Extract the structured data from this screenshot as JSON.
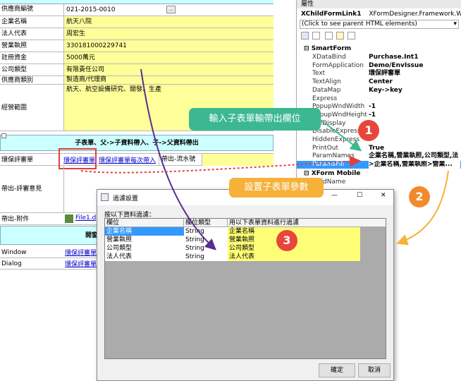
{
  "form": {
    "rows": [
      {
        "label": "供應商編號",
        "value": "021-2015-0010"
      },
      {
        "label": "企業名稱",
        "value": "航天八院"
      },
      {
        "label": "法人代表",
        "value": "周宏生"
      },
      {
        "label": "營業執照",
        "value": "330181000229741"
      },
      {
        "label": "註冊資金",
        "value": "5000萬元"
      },
      {
        "label": "公司類型",
        "value": "有限責任公司"
      },
      {
        "label": "供應商類別",
        "value": "製造商/代理商"
      },
      {
        "label": "經營範圍",
        "value": "航天、航空設備研究、開發、生產"
      }
    ],
    "band_title": "子表單、父->子資料帶入、子->父資料帶出",
    "sub_rows": {
      "env_label": "環保評審單",
      "env_link1": "環保評審單",
      "env_link2": "環保評審單每次帶入",
      "env_cell3": "帶出-流水號",
      "opinion_label": "帶出-評審意見",
      "attach_label": "帶出-附件",
      "attach_file": "File1.d",
      "open_band": "開窗",
      "window_label": "Window",
      "window_link": "環保評審單",
      "dialog_label": "Dialog",
      "dialog_link": "環保評審單"
    }
  },
  "properties": {
    "header": "屬性",
    "object_name": "XChildFormLink1",
    "object_type": "XFormDesigner.Framework.Web.UI.C(",
    "parent_hint": "(Click to see parent HTML elements)",
    "section_smartform": "SmartForm",
    "section_xform_mobile": "XForm Mobile",
    "rows": [
      {
        "name": "XDataBind",
        "value": "Purchase.Int1"
      },
      {
        "name": "FormApplication",
        "value": "Demo/EnvIssue"
      },
      {
        "name": "Text",
        "value": "環保評審單"
      },
      {
        "name": "TextAlign",
        "value": "Center"
      },
      {
        "name": "DataMap",
        "value": "Key->key"
      },
      {
        "name": "Express",
        "value": ""
      },
      {
        "name": "PopupWndWidth",
        "value": "-1"
      },
      {
        "name": "PopupWndHeight",
        "value": "-1"
      },
      {
        "name": "PreDisplay",
        "value": ""
      },
      {
        "name": "DisableExpress",
        "value": ""
      },
      {
        "name": "HiddenExpress",
        "value": ""
      },
      {
        "name": "PrintOut",
        "value": "True"
      },
      {
        "name": "ParamNames",
        "value": "企業名稱,營業執照,公司類型,法"
      },
      {
        "name": "ParamsFill",
        "value": ">企業名稱,營業執照>營業..."
      }
    ],
    "mobile_rows": [
      {
        "name": "FieldName",
        "value": ""
      }
    ]
  },
  "callouts": {
    "green": "輸入子表單輸帶出欄位",
    "orange": "設置子表單參數",
    "num1": "1",
    "num2": "2",
    "num3": "3"
  },
  "dialog": {
    "title": "過濾設置",
    "filter_label": "按以下資料過濾：",
    "columns": [
      "欄位",
      "欄位類型",
      "用以下表單資料進行過濾"
    ],
    "rows": [
      {
        "field": "企業名稱",
        "type": "String",
        "source": "企業名稱"
      },
      {
        "field": "營業執照",
        "type": "String",
        "source": "營業執照"
      },
      {
        "field": "公司類型",
        "type": "String",
        "source": "公司類型"
      },
      {
        "field": "法人代表",
        "type": "String",
        "source": "法人代表"
      }
    ],
    "ok_label": "確定",
    "cancel_label": "取消",
    "minimize_glyph": "—",
    "maximize_glyph": "☐",
    "close_glyph": "✕"
  },
  "colors": {
    "yellow_cell": "#ffff99",
    "cyan_band": "#ccffff",
    "green_callout": "#3cb890",
    "orange_callout": "#f6b13a",
    "red_circle": "#e8463b",
    "orange_circle": "#f28a2c",
    "purple_arrow": "#5a2d91",
    "selection_blue": "#3399ff"
  }
}
